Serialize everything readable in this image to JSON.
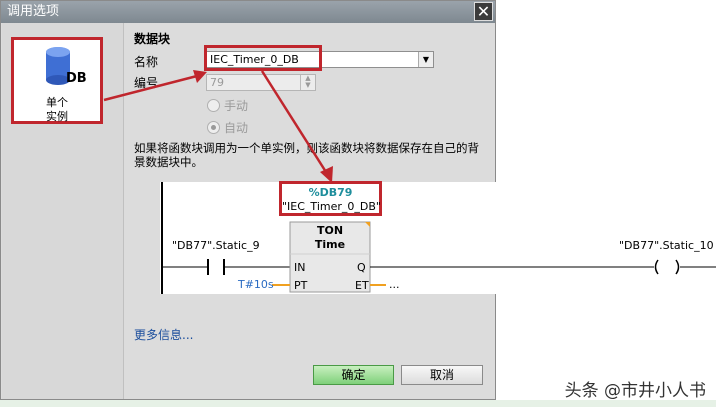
{
  "dialog": {
    "title": "调用选项",
    "close_glyph": "✕"
  },
  "instance_tile": {
    "icon_text": "DB",
    "label_line1": "单个",
    "label_line2": "实例"
  },
  "datablock": {
    "section_title": "数据块",
    "name_label": "名称",
    "name_value": "IEC_Timer_0_DB",
    "number_label": "编号",
    "number_value": "79",
    "radio_manual": "手动",
    "radio_auto": "自动",
    "auto_checked": true
  },
  "description": "如果将函数块调用为一个单实例，则该函数块将数据保存在自己的背景数据块中。",
  "ladder": {
    "db_address": "%DB79",
    "db_name": "\"IEC_Timer_0_DB\"",
    "block_type": "TON",
    "block_subtype": "Time",
    "input_tag": "\"DB77\".Static_9",
    "output_tag": "\"DB77\".Static_10",
    "pin_in": "IN",
    "pin_q": "Q",
    "pin_pt": "PT",
    "pin_et": "ET",
    "pt_value": "T#10s",
    "et_value": "..."
  },
  "more_info": "更多信息...",
  "buttons": {
    "ok": "确定",
    "cancel": "取消"
  },
  "watermark": "头条 @市井小人书",
  "colors": {
    "highlight": "#c0262d",
    "db_icon": "#3f6fd4",
    "ok_button": "#8fd887",
    "db_address": "#1e8e9c",
    "pt_value": "#2a6bc2"
  }
}
